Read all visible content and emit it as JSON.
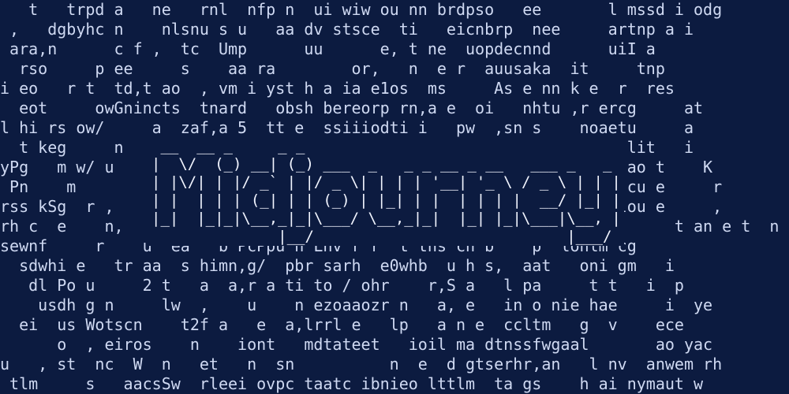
{
  "background_lines": [
    "   t   trpd a   ne   rnl  nfp n  ui wiw ou nn brdpso   ee       l mssd i odg",
    " ,   dgbyhc n    nlsnu s u   aa dv stsce  ti   eicnbrp  nee     artnp a i",
    " ara,n      c f ,  tc  Ump      uu      e, t ne  uopdecnnd      uiI a",
    "  rso     p ee     s    aa ra        or,   n  e r  auusaka  it     tnp",
    "i eo   r t  td,t ao  , vm i yst h a ia e1os  ms     As e nn k e  r  res",
    "  eot     owGnincts  tnard   obsh bereorp rn,a e  oi   nhtu ,r ercg     at",
    "l hi rs ow/     a  zaf,a 5  tt e  ssiiiodti i   pw  ,sn s    noaetu     a",
    "  t keg     n                  n n,,   ro peo r   c          iimt lit   i",
    "yPg   m w/ u                                                  pr  ao t    K",
    " Pn    m                                                      s   cu e     r",
    "rss kSg  r ,                                                  ul lou e     ,",
    "rh c  e    n,   s  oafo so                         s,tos  nf j         t an e t  n",
    "sewnf     r    u  ea   b PcPpu n Lnv r r  t ths ch b    p  lonlm cg",
    "  sdwhi e   tr aa  s himn,g/  pbr sarh  e0whb  u h s,  aat   oni gm   i",
    "   dl Po u     2 t   a  a,r a ti to / ohr    r,S a   l pa     t t   i  p",
    "    usdh g n     lw  ,    u    n ezoaaozr n   a, e   in o nie hae     i  ye",
    "  ei  us Wotscn    t2f a   e  a,lrrl e   lp   a n e  ccltm   g  v    ece",
    "      o  , eiros    n    iont   mdtateet   ioil ma dtnssfwgaal       ao yac",
    "u   , st  nc  W  n   et   n  sn          n  e  d gtserhr,an   l nv  anwem rh",
    " tlm     s   aacsSw  rleei ovpc taatc ibnieo lttlm  ta gs    h ai nymaut w"
  ],
  "logo_ascii": " __  __ _     _ _                                  \n|  \\/  (_) __| (_) ___  _   _ _ __ _ __   ___ _   _ \n| |\\/| | |/ _` | |/ _ \\| | | | '__| '_ \\ / _ \\ | | |\n| |  | | | (_| | | (_) | |_| | |  | | | |  __/ |_| |\n|_|  |_|_|\\__,_|_|\\___/ \\__,_|_|  |_| |_|\\___|\\__, |\n              |__/                            |___/ ",
  "colors": {
    "background": "#0c1b40",
    "text": "#cfd9f2",
    "logo": "#f2f5ff"
  }
}
